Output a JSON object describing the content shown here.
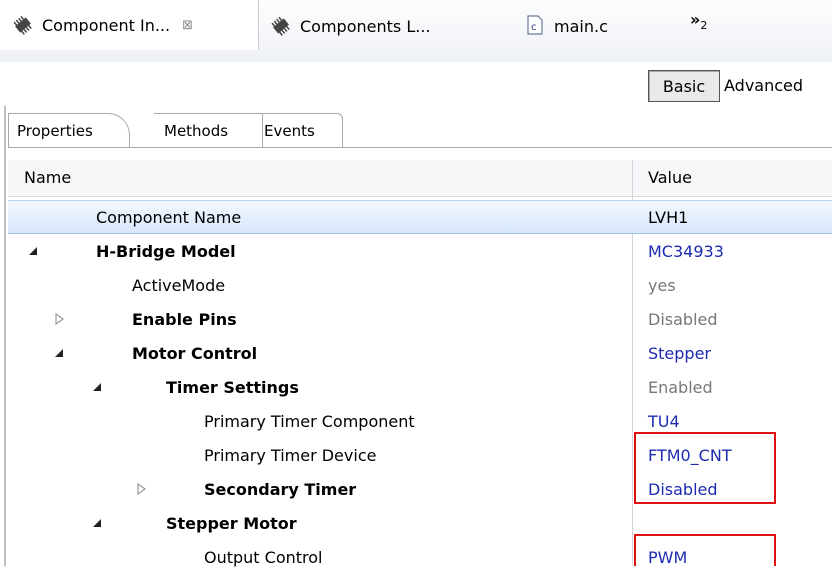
{
  "editor_tabs": [
    {
      "label": "Component In...",
      "close": "⊠"
    },
    {
      "label": "Components L..."
    },
    {
      "label": "main.c"
    }
  ],
  "overflow": {
    "chevron": "»",
    "count": "2"
  },
  "view_toggle": {
    "basic": "Basic",
    "advanced": "Advanced"
  },
  "inspector_tabs": {
    "properties": "Properties",
    "methods": "Methods",
    "events": "Events"
  },
  "table": {
    "header": {
      "name": "Name",
      "value": "Value"
    },
    "rows": [
      {
        "name": "Component Name",
        "value": "LVH1"
      },
      {
        "name": "H-Bridge Model",
        "value": "MC34933"
      },
      {
        "name": "ActiveMode",
        "value": "yes"
      },
      {
        "name": "Enable Pins",
        "value": "Disabled"
      },
      {
        "name": "Motor Control",
        "value": "Stepper"
      },
      {
        "name": "Timer Settings",
        "value": "Enabled"
      },
      {
        "name": "Primary Timer Component",
        "value": "TU4"
      },
      {
        "name": "Primary Timer Device",
        "value": "FTM0_CNT"
      },
      {
        "name": "Secondary Timer",
        "value": "Disabled"
      },
      {
        "name": "Stepper Motor",
        "value": ""
      },
      {
        "name": "Output Control",
        "value": "PWM"
      }
    ]
  },
  "colors": {
    "value_blue": "#1d2bb0",
    "highlight_red": "#e01010",
    "selection": "#d8e7fb"
  }
}
